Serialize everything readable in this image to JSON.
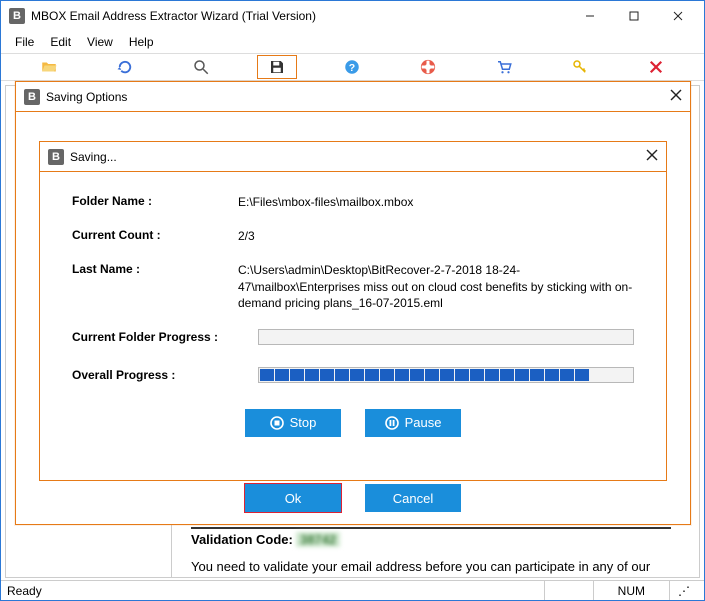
{
  "window": {
    "title": "MBOX Email Address Extractor Wizard (Trial Version)"
  },
  "menu": {
    "file": "File",
    "edit": "Edit",
    "view": "View",
    "help": "Help"
  },
  "status": {
    "ready": "Ready",
    "num": "NUM"
  },
  "validation": {
    "label": "Validation Code:",
    "code": "38742",
    "message": "You need to validate your email address before you can participate in any of our"
  },
  "saving_options": {
    "title": "Saving Options",
    "ok": "Ok",
    "cancel": "Cancel"
  },
  "saving": {
    "title": "Saving...",
    "folder_name_label": "Folder Name :",
    "folder_name": "E:\\Files\\mbox-files\\mailbox.mbox",
    "current_count_label": "Current Count :",
    "current_count": "2/3",
    "last_name_label": "Last Name :",
    "last_name": "C:\\Users\\admin\\Desktop\\BitRecover-2-7-2018 18-24-47\\mailbox\\Enterprises miss out on cloud cost benefits by sticking with on-demand pricing plans_16-07-2015.eml",
    "current_folder_progress_label": "Current Folder Progress :",
    "overall_progress_label": "Overall Progress :",
    "overall_progress_chunks": 22,
    "stop": "Stop",
    "pause": "Pause"
  }
}
